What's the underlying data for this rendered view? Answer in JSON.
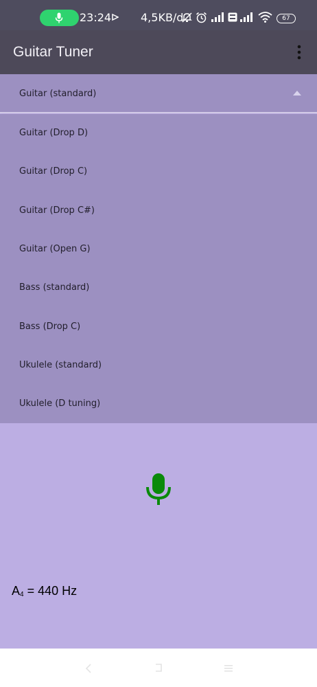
{
  "status_bar": {
    "time": "23:24",
    "net_speed": "4,5KB/d",
    "battery_level": "67",
    "icons": [
      "microphone-icon",
      "cast-icon",
      "bell-off-icon",
      "alarm-icon",
      "signal-icon",
      "volte-icon",
      "signal-icon",
      "wifi-icon",
      "battery-icon"
    ]
  },
  "app_bar": {
    "title": "Guitar Tuner",
    "menu_icon": "more-vert-icon"
  },
  "tuning_select": {
    "selected": "Guitar (standard)",
    "options": [
      "Guitar (Drop D)",
      "Guitar (Drop C)",
      "Guitar (Drop C#)",
      "Guitar (Open G)",
      "Bass (standard)",
      "Bass (Drop C)",
      "Ukulele (standard)",
      "Ukulele (D tuning)"
    ]
  },
  "reference": {
    "note": "A",
    "octave": "4",
    "rest": " = 440 Hz"
  },
  "colors": {
    "status_bar": "#4e4c5e",
    "app_bar": "#4d4959",
    "dropdown": "#9c90c1",
    "background": "#bcaee3",
    "mic_accent": "#0a8a0a",
    "recording_pill": "#2fd36f"
  },
  "nav_bar": {
    "icons": [
      "back-icon",
      "home-icon",
      "recents-icon"
    ]
  }
}
